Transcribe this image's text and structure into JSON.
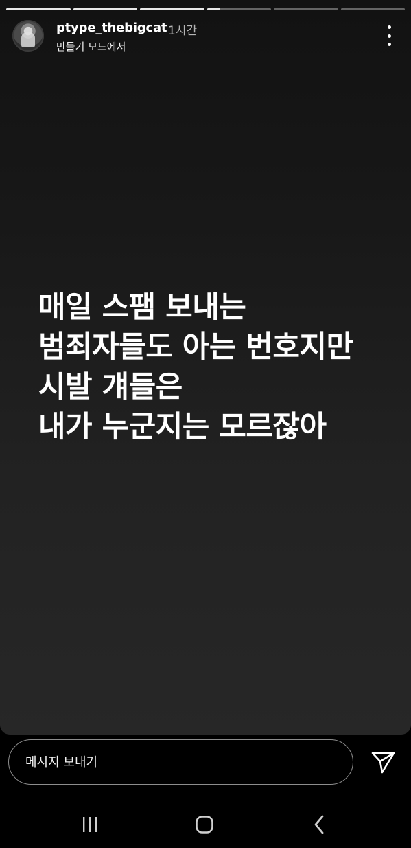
{
  "story": {
    "progress": [
      1,
      1,
      1,
      0.2,
      0,
      0
    ],
    "username": "ptype_thebigcat",
    "time": "1시간",
    "subtitle": "만들기 모드에서",
    "text_lines": [
      "매일 스팸 보내는",
      "범죄자들도 아는 번호지만",
      "시발 걔들은",
      "내가 누군지는 모르잖아"
    ]
  },
  "icons": {
    "more": "more-vertical-icon",
    "send": "send-icon",
    "recent": "recent-apps-icon",
    "home": "home-icon",
    "back": "back-icon"
  },
  "message": {
    "placeholder": "메시지 보내기"
  },
  "colors": {
    "background": "#000000",
    "story_bg": "#222222",
    "progress_active": "#e8e8e8"
  }
}
